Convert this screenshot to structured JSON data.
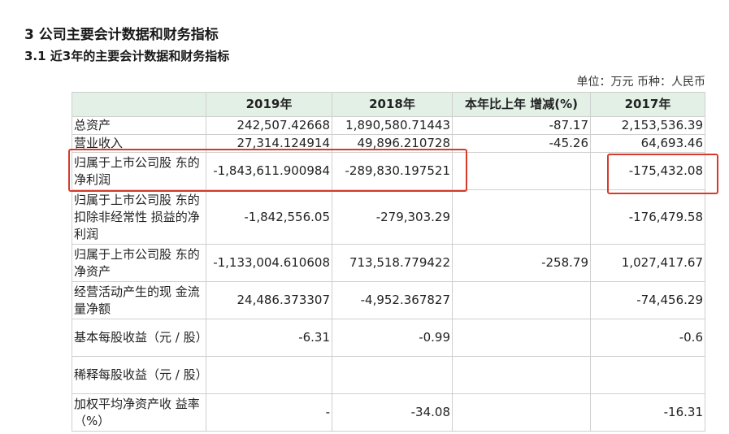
{
  "doc": {
    "heading": "3 公司主要会计数据和财务指标",
    "subheading": "3.1 近3年的主要会计数据和财务指标",
    "unit_note": "单位：万元 币种：人民币"
  },
  "table": {
    "headers": [
      "",
      "2019年",
      "2018年",
      "本年比上年 增减(%)",
      "2017年"
    ],
    "rows": [
      {
        "label": "总资产",
        "v2019": "242,507.42668",
        "v2018": "1,890,580.71443",
        "change": "-87.17",
        "v2017": "2,153,536.39"
      },
      {
        "label": "营业收入",
        "v2019": "27,314.124914",
        "v2018": "49,896.210728",
        "change": "-45.26",
        "v2017": "64,693.46"
      },
      {
        "label": "归属于上市公司股 东的净利润",
        "v2019": "-1,843,611.900984",
        "v2018": "-289,830.197521",
        "change": "",
        "v2017": "-175,432.08"
      },
      {
        "label": "归属于上市公司股 东的扣除非经常性 损益的净利润",
        "v2019": "-1,842,556.05",
        "v2018": "-279,303.29",
        "change": "",
        "v2017": "-176,479.58"
      },
      {
        "label": "归属于上市公司股 东的净资产",
        "v2019": "-1,133,004.610608",
        "v2018": "713,518.779422",
        "change": "-258.79",
        "v2017": "1,027,417.67"
      },
      {
        "label": "经营活动产生的现 金流量净额",
        "v2019": "24,486.373307",
        "v2018": "-4,952.367827",
        "change": "",
        "v2017": "-74,456.29"
      },
      {
        "label": "基本每股收益（元 / 股）",
        "v2019": "-6.31",
        "v2018": "-0.99",
        "change": "",
        "v2017": "-0.6"
      },
      {
        "label": "稀释每股收益（元 / 股）",
        "v2019": "",
        "v2018": "",
        "change": "",
        "v2017": ""
      },
      {
        "label": "加权平均净资产收 益率（%）",
        "v2019": "-",
        "v2018": "-34.08",
        "change": "",
        "v2017": "-16.31"
      }
    ]
  },
  "colors": {
    "header_bg": "#e3f0e6",
    "highlight": "#d83a2a",
    "border": "#cfcfcf"
  }
}
